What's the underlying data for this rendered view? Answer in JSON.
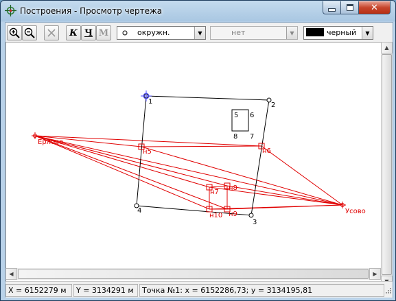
{
  "window": {
    "title": "Построения - Просмотр чертежа"
  },
  "toolbar": {
    "zoom_in_icon": "zoom-in-icon",
    "zoom_out_icon": "zoom-out-icon",
    "delete_icon": "delete-icon",
    "bold_label": "К",
    "underline_label": "Ч",
    "m_label": "М",
    "point_style_value": "окружн.",
    "line_style_value": "нет",
    "color_value": "черный",
    "color_swatch": "#000000"
  },
  "drawing": {
    "parcel_points": [
      "1",
      "2",
      "3",
      "4"
    ],
    "building_labels": [
      "5",
      "6",
      "7",
      "8"
    ],
    "station_labels": [
      "Ерлово",
      "Усово"
    ],
    "red_points": [
      "н5",
      "н6",
      "н7",
      "н8",
      "н10",
      "н9"
    ],
    "black_color": "#000000",
    "red_color": "#e00000"
  },
  "statusbar": {
    "x": "X = 6152279 м",
    "y": "Y = 3134291 м",
    "point": "Точка №1: x = 6152286,73; y = 3134195,81"
  }
}
